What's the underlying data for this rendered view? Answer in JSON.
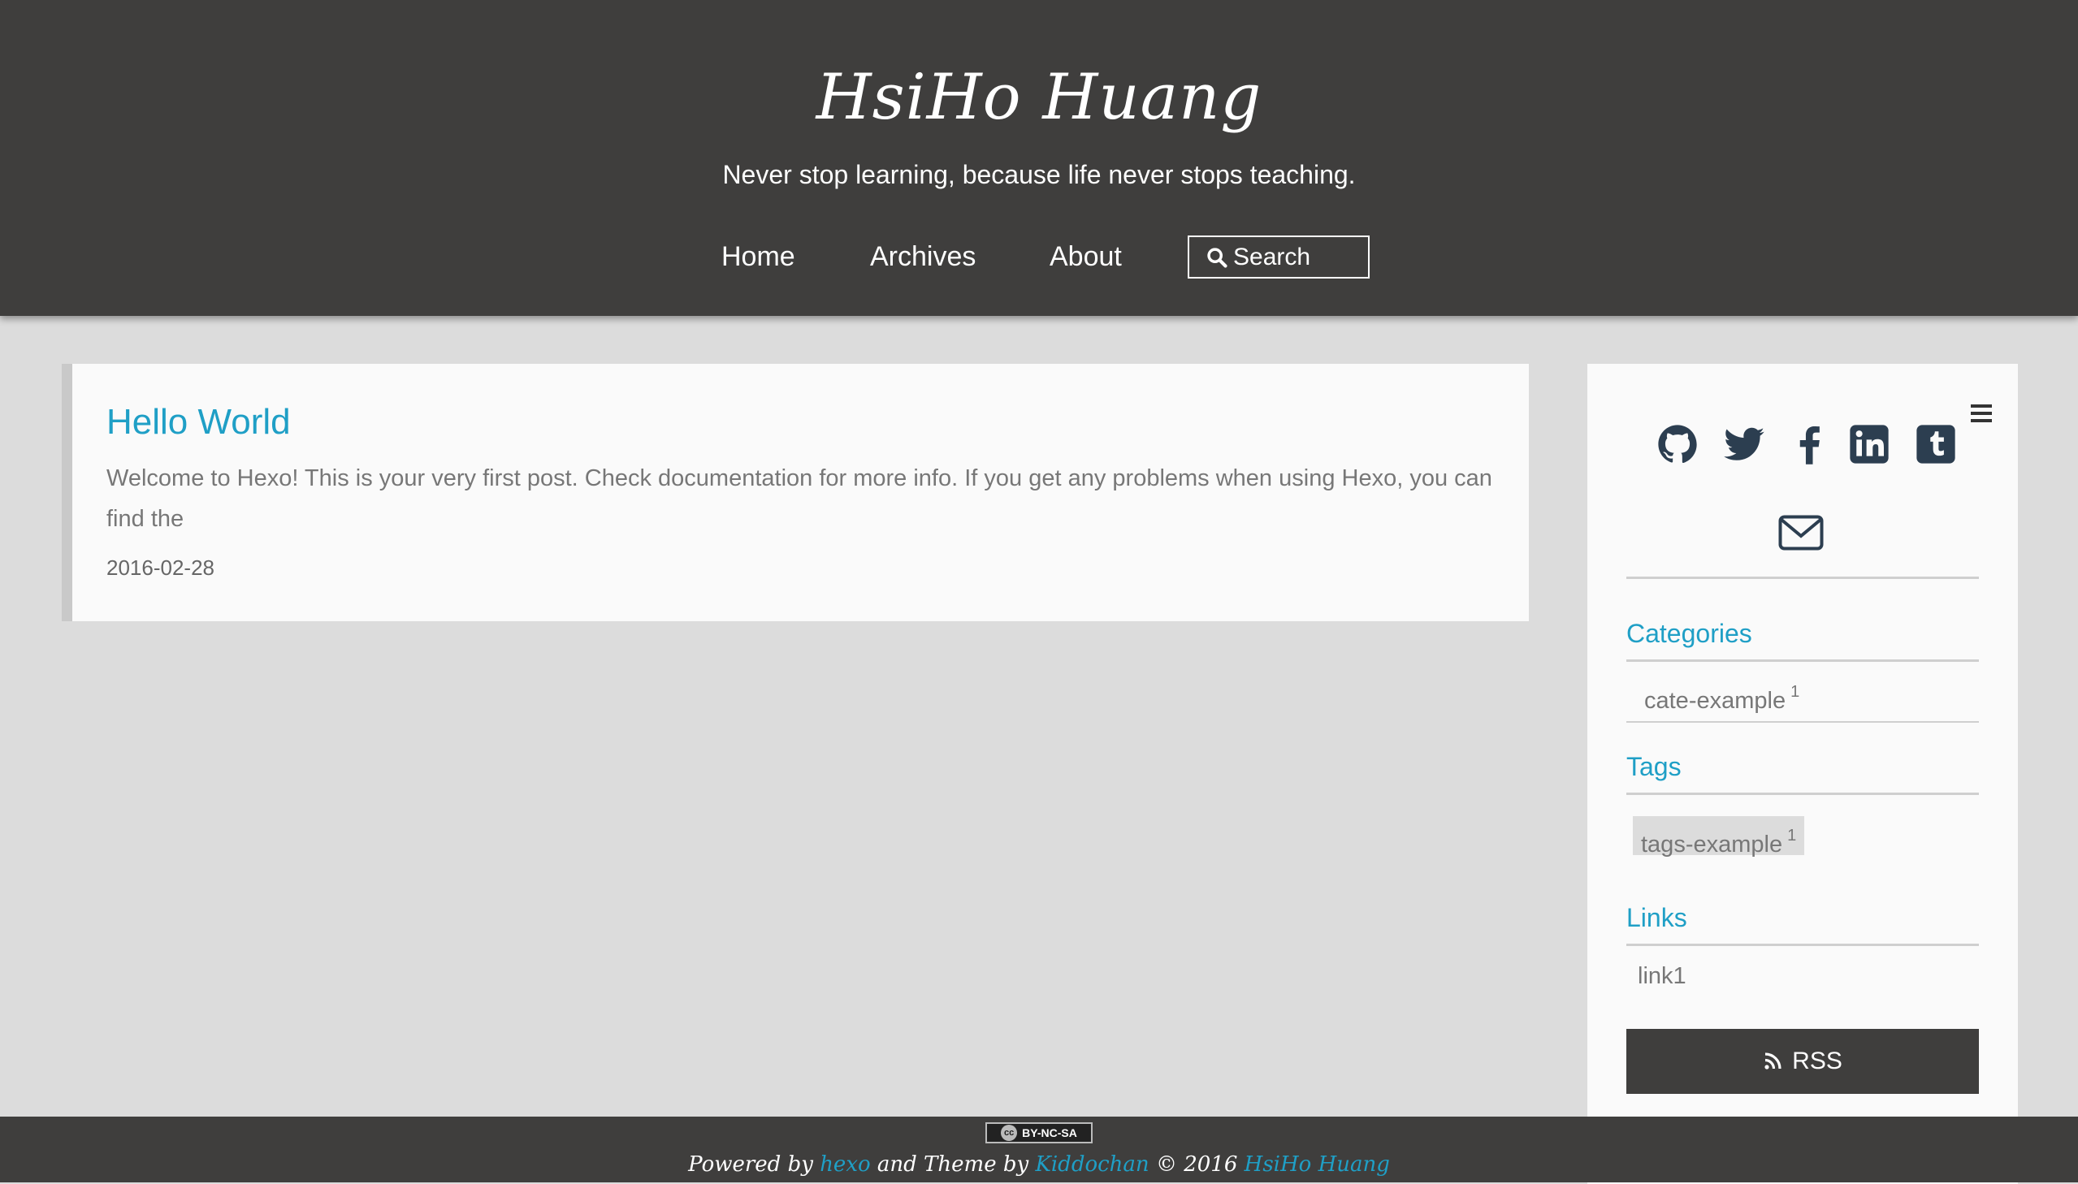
{
  "header": {
    "title": "HsiHo Huang",
    "subtitle": "Never stop learning, because life never stops teaching.",
    "nav": {
      "home": "Home",
      "archives": "Archives",
      "about": "About",
      "search": "Search"
    }
  },
  "post": {
    "title": "Hello World",
    "excerpt": "Welcome to Hexo! This is your very first post. Check documentation for more info. If you get any problems when using Hexo, you can find the",
    "date": "2016-02-28"
  },
  "sidebar": {
    "social_icons": [
      "github-icon",
      "twitter-icon",
      "facebook-icon",
      "linkedin-icon",
      "tumblr-icon",
      "mail-icon"
    ],
    "categories_title": "Categories",
    "category": {
      "name": "cate-example",
      "count": "1"
    },
    "tags_title": "Tags",
    "tag": {
      "name": "tags-example",
      "count": "1"
    },
    "links_title": "Links",
    "link": "link1",
    "rss": "RSS"
  },
  "footer": {
    "license": "BY-NC-SA",
    "cc": "cc",
    "powered_by": "Powered by",
    "hexo": "hexo",
    "and_theme_by": "and Theme by",
    "theme_author": "Kiddochan",
    "copyright": "© 2016",
    "author": "HsiHo Huang"
  },
  "colors": {
    "header_bg": "#3f3e3d",
    "page_bg": "#dcdcdc",
    "accent": "#1f9fc6",
    "card_bg": "#fafafa"
  }
}
